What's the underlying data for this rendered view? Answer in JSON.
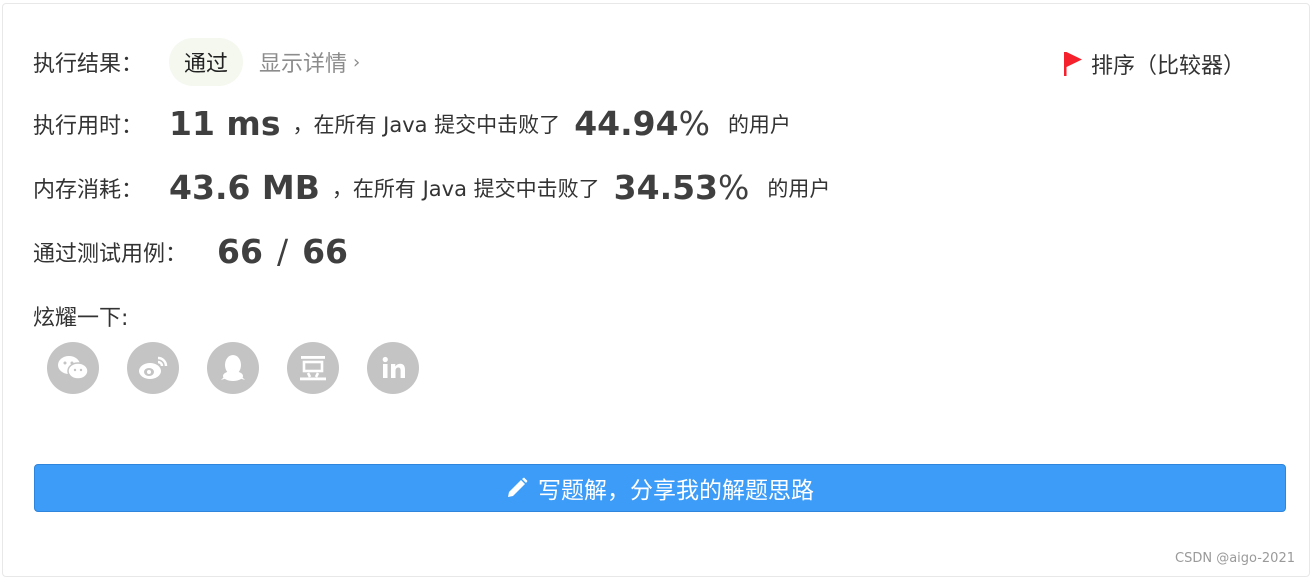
{
  "result": {
    "label": "执行结果：",
    "status": "通过",
    "details_link": "显示详情",
    "sort_label": "排序（比较器）"
  },
  "runtime": {
    "label": "执行用时：",
    "value": "11 ms",
    "mid": "，在所有 Java 提交中击败了",
    "percent": "44.94",
    "percent_sym": "%",
    "tail": "的用户"
  },
  "memory": {
    "label": "内存消耗：",
    "value": "43.6 MB",
    "mid": "，在所有 Java 提交中击败了",
    "percent": "34.53",
    "percent_sym": "%",
    "tail": "的用户"
  },
  "testcases": {
    "label": "通过测试用例：",
    "passed": "66",
    "slash": "/",
    "total": "66"
  },
  "share": {
    "label": "炫耀一下:",
    "icons": [
      "wechat-icon",
      "weibo-icon",
      "qq-icon",
      "douban-icon",
      "linkedin-icon"
    ]
  },
  "write_button": "写题解，分享我的解题思路",
  "watermark": "CSDN @aigo-2021",
  "colors": {
    "accent": "#3d9cf7",
    "flag": "#f5222d",
    "pill_bg": "#f4f8ef",
    "icon_bg": "#c4c4c4"
  }
}
